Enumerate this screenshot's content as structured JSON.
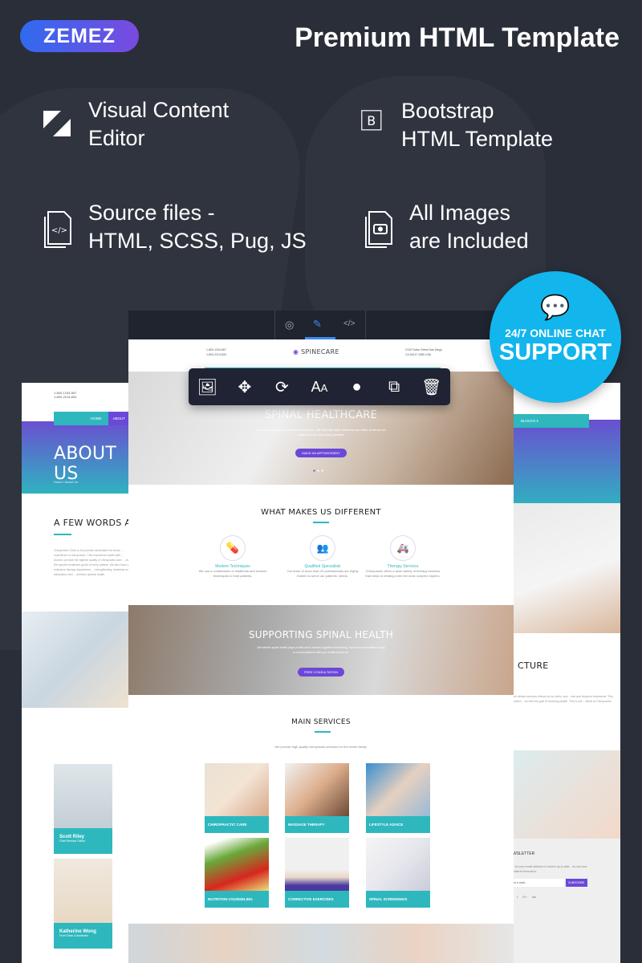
{
  "brand": {
    "logo": "ZEMEZ",
    "title": "Premium HTML Template"
  },
  "features": [
    {
      "icon": "editor-icon",
      "text": "Visual Content\nEditor"
    },
    {
      "icon": "bootstrap-icon",
      "text": "Bootstrap\nHTML Template"
    },
    {
      "icon": "source-files-icon",
      "text": "Source files -\nHTML, SCSS, Pug, JS"
    },
    {
      "icon": "images-icon",
      "text": "All Images\nare Included"
    }
  ],
  "support": {
    "line1": "24/7 ONLINE CHAT",
    "line2": "SUPPORT"
  },
  "toolbar": [
    "image-icon",
    "move-icon",
    "refresh-icon",
    "font-size-icon",
    "color-icon",
    "duplicate-icon",
    "trash-icon"
  ],
  "main_mock": {
    "phones": "1-800-1234-567\n1-800-2214-834",
    "logo": "SPINECARE",
    "address": "2130 Fulton Street San Diego\nCA 94117-1080 USA",
    "hero": {
      "title": "SPINAL HEALTHCARE",
      "text": "We welcome you to a warm environment, with friendly staff members who wish to serve our patients in the best way possible.",
      "button": "MAKE AN APPOINTMENT"
    },
    "different": {
      "title": "WHAT MAKES US DIFFERENT",
      "items": [
        {
          "title": "Modern Techniques",
          "text": "We use a combination of traditional and modern techniques to heal patients."
        },
        {
          "title": "Qualified Specialists",
          "text": "Our team of more than 20 professionals are highly trained to serve our patients' needs."
        },
        {
          "title": "Therapy Services",
          "text": "Chiropractic offers a wide variety of therapy services that helps in treating even the most complex injuries."
        }
      ]
    },
    "cta": {
      "title": "SUPPORTING SPINAL HEALTH",
      "text": "We believe spinal health plays a vital role in human organism functioning. Get a free consultation today to avoid problems with your health tomorrow.",
      "button": "FREE CONSULTATION"
    },
    "services": {
      "title": "MAIN SERVICES",
      "subtitle": "We provide high quality chiropractic services for the whole family.",
      "items": [
        "CHIROPRACTIC CARE",
        "MASSAGE THERAPY",
        "LIFESTYLE ADVICE",
        "NUTRITION COUNSELING",
        "CORRECTIVE EXERCISES",
        "SPINAL SCREENINGS"
      ]
    }
  },
  "left_mock": {
    "phones": "1-800-1234-567\n1-800-2214-834",
    "nav": [
      "HOME",
      "ABOUT"
    ],
    "title": "ABOUT US",
    "breadcrumb": "Home  /  About Us",
    "section": "A FEW WORDS ABO",
    "text": "Chiropractic Clinic is the premier destination for those ... experience in chiropractic. This experience starts with ... doctors, provide the highest quality of chiropractic care ... meet the specific treatment goals of every patient. We also have an extensive therapy department ... strengthening, electrical muscle stimulation and ... achieve optimal health.",
    "team": [
      {
        "name": "Scott Riley",
        "role": "Chief Medical Officer"
      },
      {
        "name": "Katherine Wong",
        "role": "Front Desk Coordinator"
      }
    ]
  },
  "right_mock": {
    "nav": "BLOCKS ▾",
    "section": "CTURE",
    "text": "...most utilized services offered at our clinic, and ...ular and frequent treatments. This stimulation ...ne with the goal of restoring health. This is one ...tients at Chiropractic.",
    "newsletter": "WSLETTER",
    "newsletter_text": "...ter your email address to receive up-to-date ...es and new patient information.",
    "email_placeholder": "Your e-mail...",
    "subscribe": "SUBSCRIBE",
    "social": [
      "f",
      "t",
      "G+",
      "rss"
    ]
  },
  "colors": {
    "bg": "#2a2e39",
    "teal": "#2eb8be",
    "purple": "#6b48d8",
    "badge": "#12b5ec"
  }
}
